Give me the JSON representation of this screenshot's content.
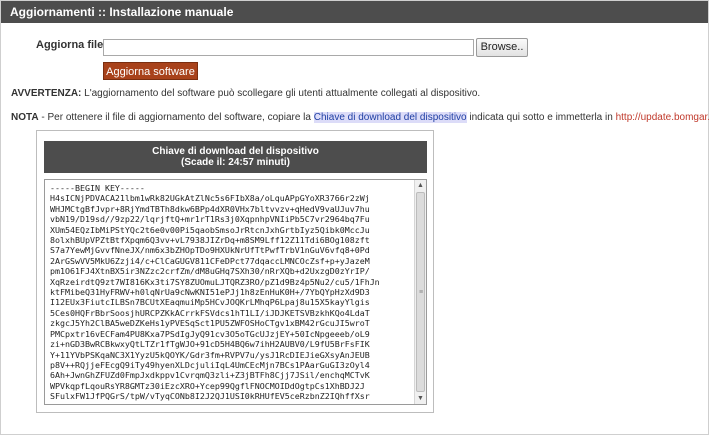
{
  "header": {
    "title": "Aggiornamenti :: Installazione manuale"
  },
  "upload": {
    "file_label": "Aggiorna file:",
    "file_value": "",
    "browse_label": "Browse..",
    "submit_label": "Aggiorna software"
  },
  "warning": {
    "label": "AVVERTENZA:",
    "text": " L'aggiornamento del software può scollegare gli utenti attualmente collegati al dispositivo."
  },
  "note": {
    "label": "NOTA",
    "text_before": " - Per ottenere il file di aggiornamento del software, copiare la ",
    "key_link": "Chiave di download del dispositivo",
    "text_middle": " indicata qui sotto e immetterla in ",
    "url_link": "http://update.bomgar.com",
    "text_after": "."
  },
  "key_panel": {
    "title": "Chiave di download del dispositivo",
    "expiry": "(Scade il: 24:57 minuti)",
    "key_text": "-----BEGIN KEY-----\nH4sICNjPDVACA21lbm1wRk82UGkAtZlNc5s6FIbX8a/oLquAPpGYoXR3766r2zWj\nWHJMCtgBfJvpr+8RjYmdTBTh8dkw6BPp4dXR0VHx7bltvvzv+qHedV9vaUJuv7hu\nvbN19/D19sd//9zp22/lqrjftQ+mr1rT1Rs3j0XqpnhpVNIiPb5C7vr2964bq7Fu\nXUm54EQzIbMiPStYQc2t6e0v00Pi5qaobSmsoJrRtcnJxhGrtbIyz5Qibk0MccJu\n8olxhBUpVPZtBtfXpqm6Q3vv+vL7938JIZrDq+m8SM9Lff12Z11Tdi6BOg108zft\nS7a7YewMjGvvfNneJX/nm6x3bZHOpTDo9HXUkNrUfTtPwfTrbV1nGuV6vfq8+0Pd\n2ArGSwVV5MkU6Zzji4/c+ClCaGUGV811CFeDPct77dqaccLMNCOcZsf+p+yJazeM\npm1O61FJ4XtnBX5ir3NZzc2crfZm/dM8uGHq7SXh30/nRrXQb+d2UxzgD0zYrIP/\nXqRzeirdtQ9zt7WI816Kx3ti7SY8ZUOmuLJTQRZ3RO/pZ1d9Bz4p5Nu2/cu5/1FhJn\nktFMibeQ31HyFRWV+h0lqNrUa9cNwKNI51ePJj1h8zEnHuK0H+/7YbQYpHzXd9D3\nI12EUx3FiutcILBSn7BCUtXEaqmuiMp5HCvJOQKrLMhqP6Lpaj8u15X5kayYlgis\n5Ces0HQFrBbrSoosjhURCPZKkACrrkFSVdcs1hT1LI/iJDJKETSVBzkhKQo4LdaT\nzkgcJ5Yh2ClBA5weDZKeHs1yPVESqSct1PU5ZWFOSHoCTgv1xBM42rGcuJI5wroT\nPMCpxtr16vECFam4PU8Kxa7PSdIgJyQ91cv3O5oTGcUJzjEY+50IcNpgeeeb/oL9\nzi+nGD3BwRCBkwxyQtLTZr1fTgWJO+91cD5H4BQ6w7ihH2AUBV0/L9fU5BrFsFIK\nY+11YVbPSKqaNC3X1YyzU5kQOYK/Gdr3fm+RVPV7u/ysJ1RcDIEJieGXsyAnJEUB\np8V++RQjjeFEcgQ9iTy49hyenXLDcjuliIqL4UmCEcMjn7BCs1PAarGuGI3zOyl4\n6Ah+JwnGhZFUZd0FmpJxdkppv1CvrqmQ3zli+Z3jBTFh8Cjj7JSil/enchqMCTvK\nWPVkqpfLqouRsYR8GMTz30iEzcXRO+Ycep99QgflFNOCMOIDdOgtpCs1XhBDJ2J\nSFulxFW1JfPQGrS/tpW/vTyqCONb8I2J2QJ1USI0kRHUfEV5ceRzbnZ2IQhffXsr"
  }
}
